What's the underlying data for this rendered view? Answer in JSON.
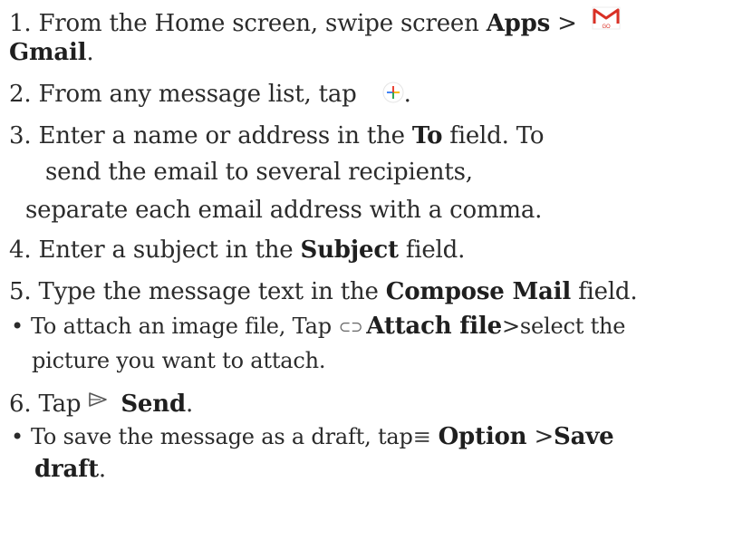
{
  "steps": {
    "s1": {
      "prefix": "1. From the Home screen, swipe screen ",
      "bold1": "Apps",
      "sep": " >",
      "bold2": "Gmail",
      "end": ".",
      "icon": "gmail-go-icon",
      "icon_text": "GO"
    },
    "s2": {
      "prefix": "2. From any message list, tap",
      "end": ".",
      "icon": "compose-plus-icon"
    },
    "s3": {
      "prefix": "3. Enter a name or address in the ",
      "bold": "To",
      "suffix": " field. To",
      "line2": "send the email to several recipients,",
      "line3": "separate each email address with a comma."
    },
    "s4": {
      "prefix": "4. Enter a subject in the ",
      "bold": "Subject",
      "suffix": " field."
    },
    "s5": {
      "prefix": "5. Type the message text in the ",
      "bold": "Compose Mail",
      "suffix": " field.",
      "bullet": {
        "prefix": "To attach an image file, Tap",
        "icon": "paperclip-icon",
        "bold": "Attach file",
        "suffix": ">select the",
        "line2": "picture you want to attach."
      }
    },
    "s6": {
      "prefix": "6. Tap",
      "icon": "send-icon",
      "bold": "Send",
      "end": ".",
      "bullet": {
        "prefix": "To save the message as a draft, tap",
        "icon": "menu-icon",
        "bold1": "Option",
        "sep": " >",
        "bold2": "Save",
        "line2_bold": "draft",
        "end": "."
      }
    }
  },
  "colors": {
    "text": "#2b2b2b",
    "gmail_red": "#d93025",
    "compose_blue": "#4285f4",
    "compose_red": "#ea4335",
    "compose_yellow": "#fbbc04",
    "compose_green": "#34a853"
  }
}
